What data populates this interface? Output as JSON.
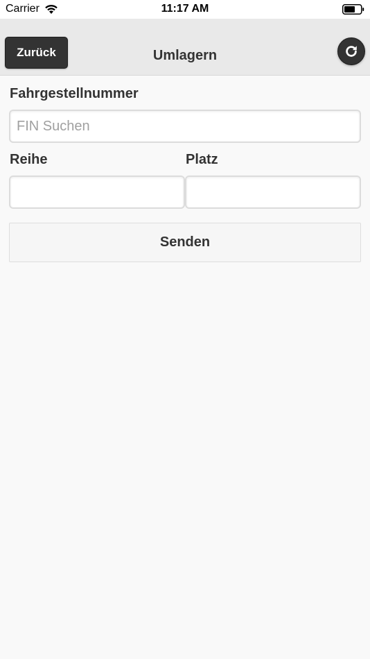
{
  "status_bar": {
    "carrier": "Carrier",
    "time": "11:17 AM",
    "icons": [
      "wifi-icon",
      "battery-icon"
    ]
  },
  "header": {
    "back_label": "Zurück",
    "title": "Umlagern",
    "refresh_icon": "refresh-icon"
  },
  "form": {
    "fin": {
      "label": "Fahrgestellnummer",
      "value": "",
      "placeholder": "FIN Suchen"
    },
    "row": {
      "label": "Reihe",
      "value": "",
      "placeholder": ""
    },
    "place": {
      "label": "Platz",
      "value": "",
      "placeholder": ""
    },
    "submit_label": "Senden"
  },
  "colors": {
    "header_bg": "#e9e9e9",
    "button_dark": "#333333",
    "page_bg": "#f9f9f9",
    "text": "#333333"
  }
}
